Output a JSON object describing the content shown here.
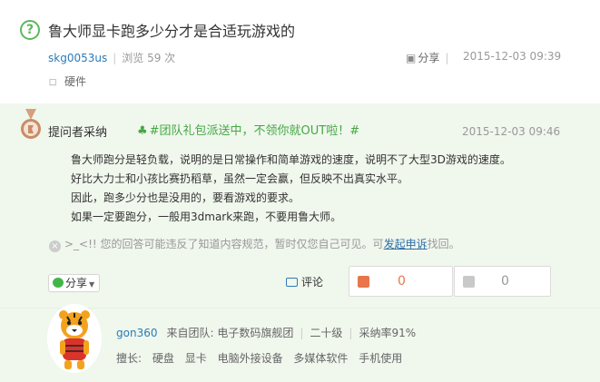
{
  "question": {
    "icon": "question-circle-icon",
    "title": "鲁大师显卡跑多少分才是合适玩游戏的",
    "user": "skg0053us",
    "views": "浏览 59 次",
    "share_label": "分享",
    "date": "2015-12-03 09:39",
    "tag": "硬件"
  },
  "answer": {
    "badge": "提问者采纳",
    "promo": "#团队礼包派送中，不领你就OUT啦！#",
    "date": "2015-12-03 09:46",
    "lines": [
      "鲁大师跑分是轻负载，说明的是日常操作和简单游戏的速度，说明不了大型3D游戏的速度。",
      "好比大力士和小孩比赛扔稻草，虽然一定会赢，但反映不出真实水平。",
      "因此，跑多少分也是没用的，要看游戏的要求。",
      "如果一定要跑分，一般用3dmark来跑，不要用鲁大师。"
    ],
    "notice_prefix": ">_<!! 您的回答可能违反了知道内容规范，暂时仅您自己可见。可",
    "notice_link": "发起申诉",
    "notice_suffix": "找回。",
    "share_label": "分享",
    "comment_label": "评论",
    "upvotes": "0",
    "downvotes": "0"
  },
  "answerer": {
    "name": "gon360",
    "team": "来自团队: 电子数码旗舰团",
    "level": "二十级",
    "adoption": "采纳率91%",
    "skills_label": "擅长:",
    "skills": [
      "硬盘",
      "显卡",
      "电脑外接设备",
      "多媒体软件",
      "手机使用"
    ]
  },
  "colors": {
    "accent_green": "#44a844",
    "link_blue": "#2b7bb9",
    "answer_bg": "#f0f7ed",
    "upvote": "#e8764b"
  }
}
